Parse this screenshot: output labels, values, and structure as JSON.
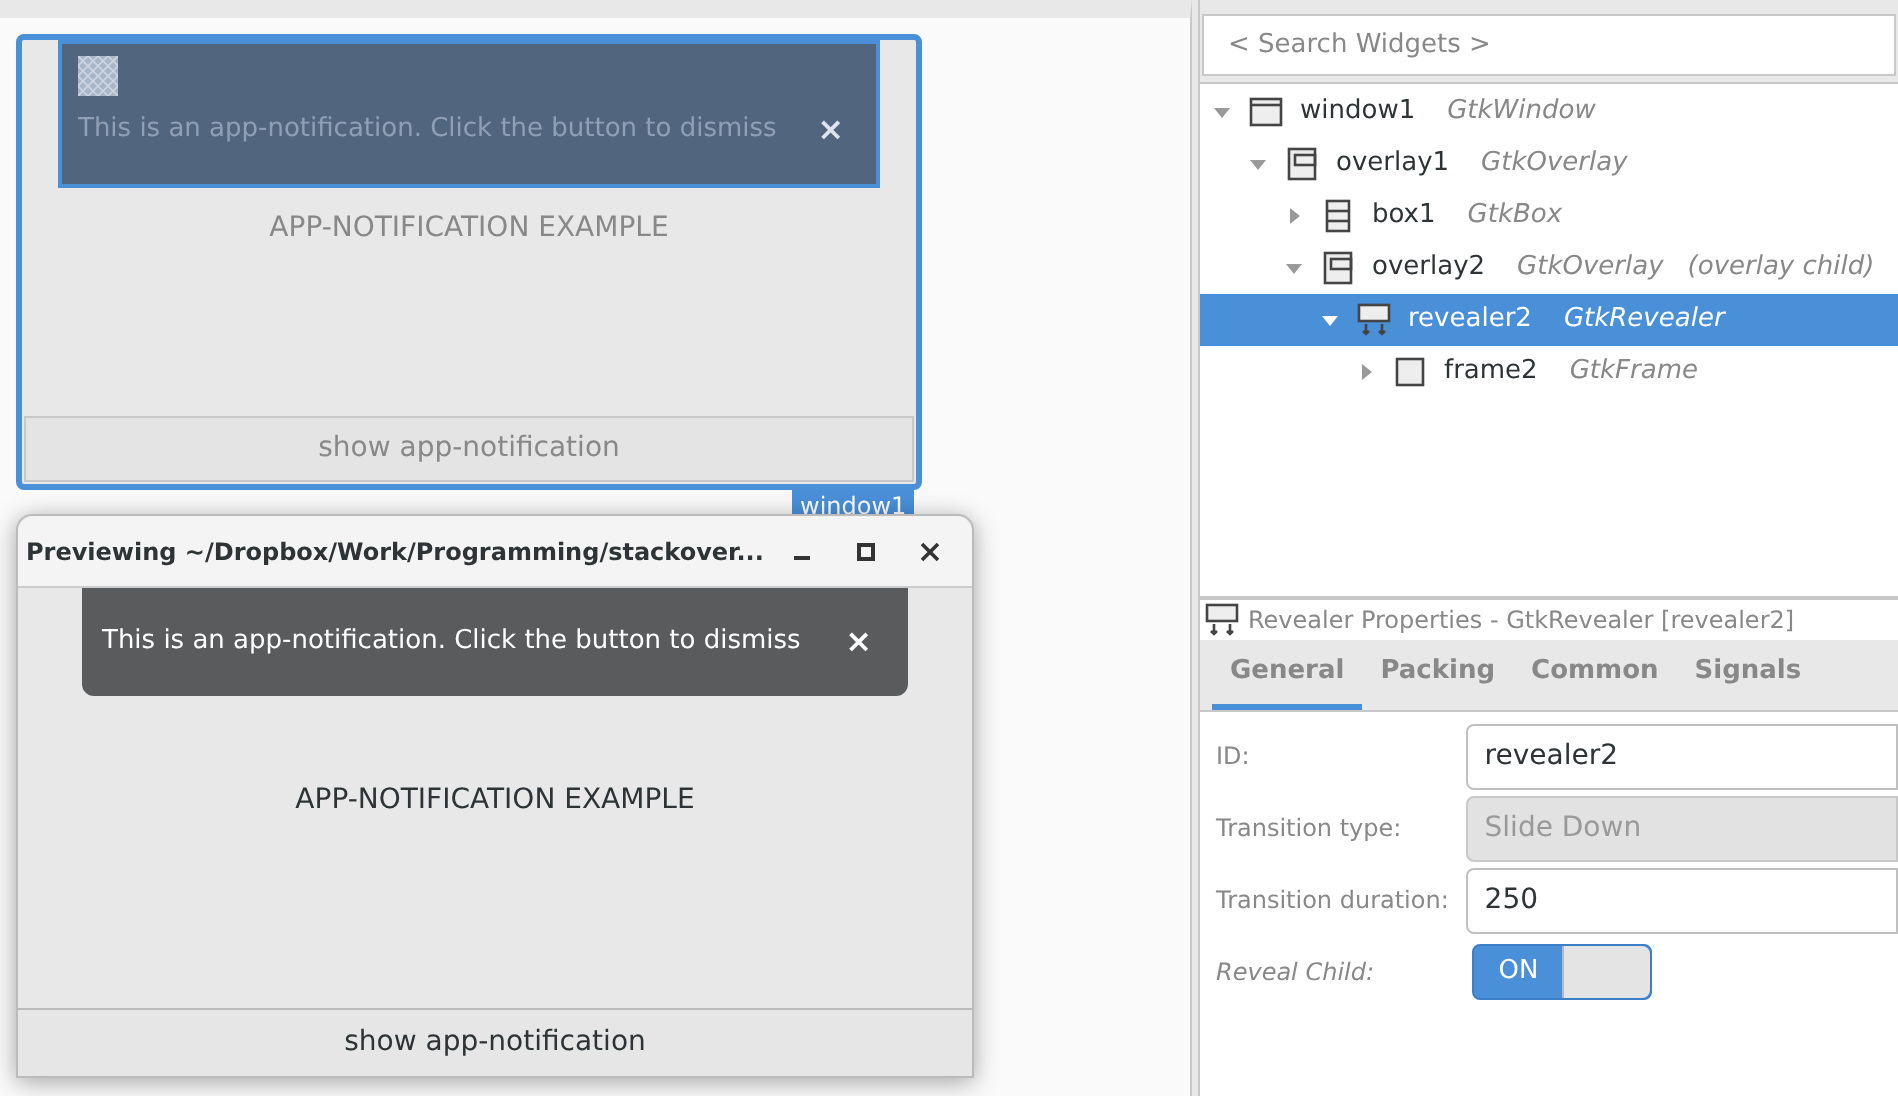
{
  "design_window": {
    "notification": {
      "text": "This is an app-notification. Click the button to dismiss",
      "close": "×"
    },
    "label": "APP-NOTIFICATION EXAMPLE",
    "button": "show app-notification",
    "tag": "window1"
  },
  "preview_window": {
    "title": "Previewing ~/Dropbox/Work/Programming/stackover...",
    "notification": {
      "text": "This is an app-notification. Click the button to dismiss",
      "close": "×"
    },
    "label": "APP-NOTIFICATION EXAMPLE",
    "button": "show app-notification"
  },
  "search": {
    "placeholder": "< Search Widgets >"
  },
  "tree": [
    {
      "name": "window1",
      "type": "GtkWindow",
      "kind": "window",
      "expanded": true,
      "selected": false,
      "children": [
        {
          "name": "overlay1",
          "type": "GtkOverlay",
          "kind": "overlay",
          "expanded": true,
          "selected": false,
          "children": [
            {
              "name": "box1",
              "type": "GtkBox",
              "kind": "box",
              "expanded": false,
              "selected": false
            },
            {
              "name": "overlay2",
              "type": "GtkOverlay",
              "note": "(overlay child)",
              "kind": "overlay",
              "expanded": true,
              "selected": false,
              "children": [
                {
                  "name": "revealer2",
                  "type": "GtkRevealer",
                  "kind": "revealer",
                  "expanded": true,
                  "selected": true,
                  "children": [
                    {
                      "name": "frame2",
                      "type": "GtkFrame",
                      "kind": "frame",
                      "expanded": false,
                      "selected": false
                    }
                  ]
                }
              ]
            }
          ]
        }
      ]
    }
  ],
  "properties": {
    "title": "Revealer Properties - GtkRevealer [revealer2]",
    "tabs": [
      {
        "label": "General",
        "selected": true
      },
      {
        "label": "Packing",
        "selected": false
      },
      {
        "label": "Common",
        "selected": false
      },
      {
        "label": "Signals",
        "selected": false
      }
    ],
    "fields": [
      {
        "label": "ID:",
        "kind": "text",
        "value": "revealer2",
        "disabled": false
      },
      {
        "label": "Transition type:",
        "kind": "combo",
        "value": "Slide Down",
        "disabled": true
      },
      {
        "label": "Transition duration:",
        "kind": "text",
        "value": "250",
        "disabled": false
      },
      {
        "label": "Reveal Child:",
        "kind": "switch",
        "value": "ON",
        "on": true
      }
    ]
  }
}
